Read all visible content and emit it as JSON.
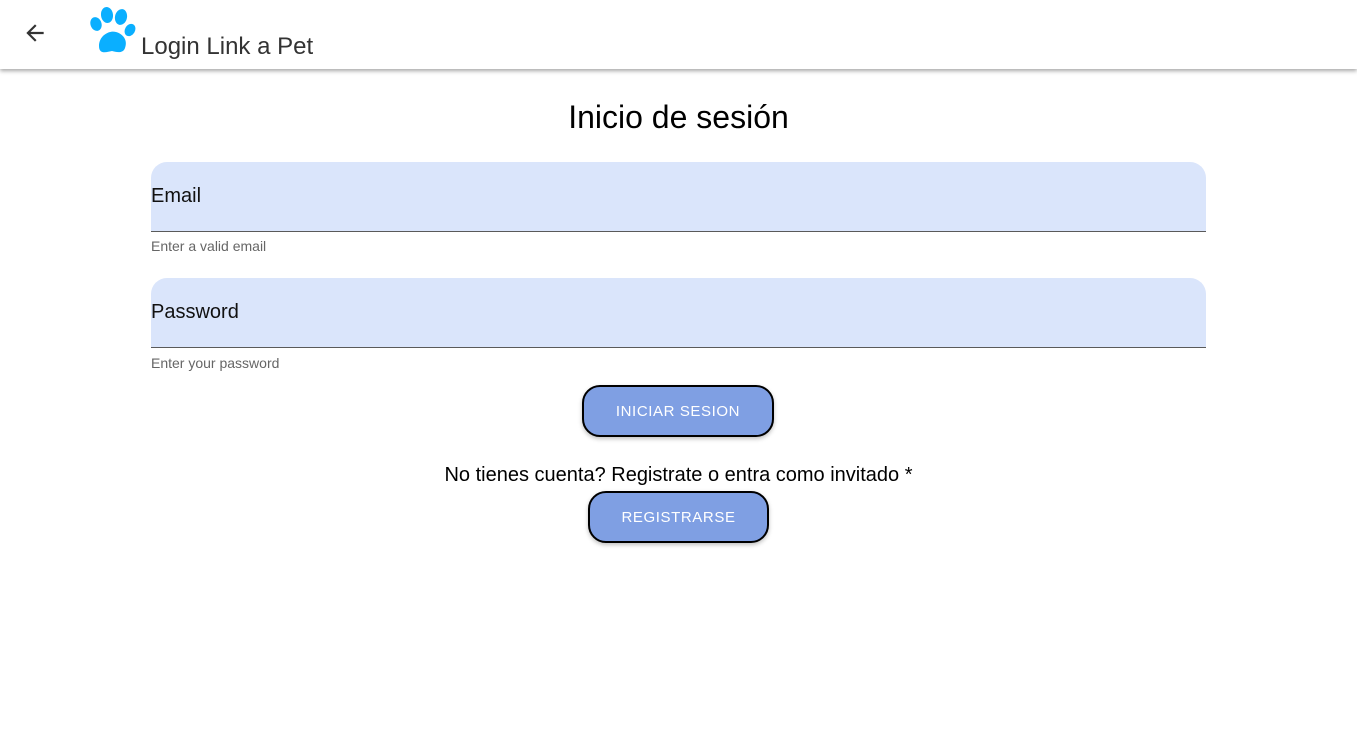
{
  "toolbar": {
    "back_icon": "arrow-left-icon",
    "logo_icon": "paw-icon",
    "logo_color": "#0aafff",
    "title": "Login Link a Pet"
  },
  "login": {
    "heading": "Inicio de sesión",
    "email": {
      "label": "Email",
      "value": "",
      "hint": "Enter a valid email"
    },
    "password": {
      "label": "Password",
      "value": "",
      "hint": "Enter your password"
    },
    "submit_label": "INICIAR SESION"
  },
  "signup": {
    "prompt": "No tienes cuenta? Registrate o entra como invitado *",
    "button_label": "REGISTRARSE"
  },
  "colors": {
    "field_background": "#dae5fb",
    "button_background": "#7f9fe3",
    "button_text": "#ffffff"
  }
}
